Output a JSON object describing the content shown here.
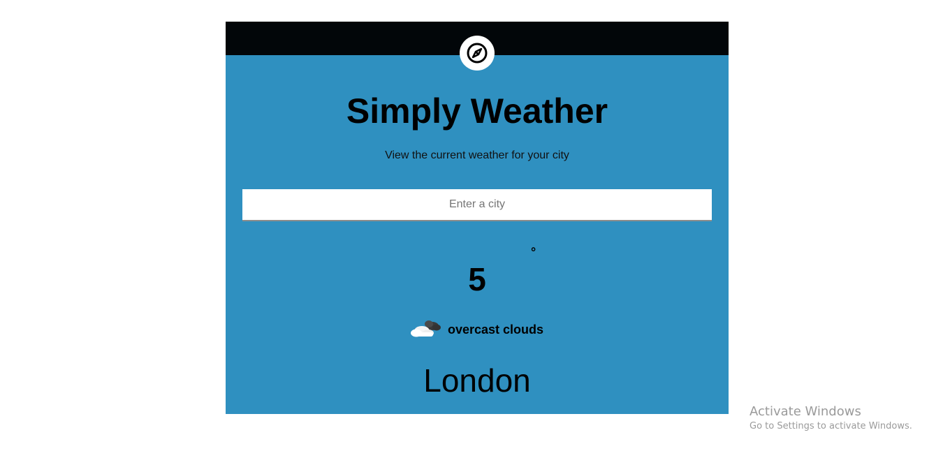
{
  "app": {
    "title": "Simply Weather",
    "subtitle": "View the current weather for your city",
    "logo_icon": "compass-icon",
    "colors": {
      "card_background": "#2f90c0",
      "topbar_background": "#020609"
    }
  },
  "search": {
    "placeholder": "Enter a city",
    "value": ""
  },
  "weather": {
    "temperature": "5",
    "degree_symbol": "°",
    "condition": "overcast clouds",
    "condition_icon": "cloud-icon",
    "city": "London"
  },
  "watermark": {
    "title": "Activate Windows",
    "subtitle": "Go to Settings to activate Windows."
  }
}
